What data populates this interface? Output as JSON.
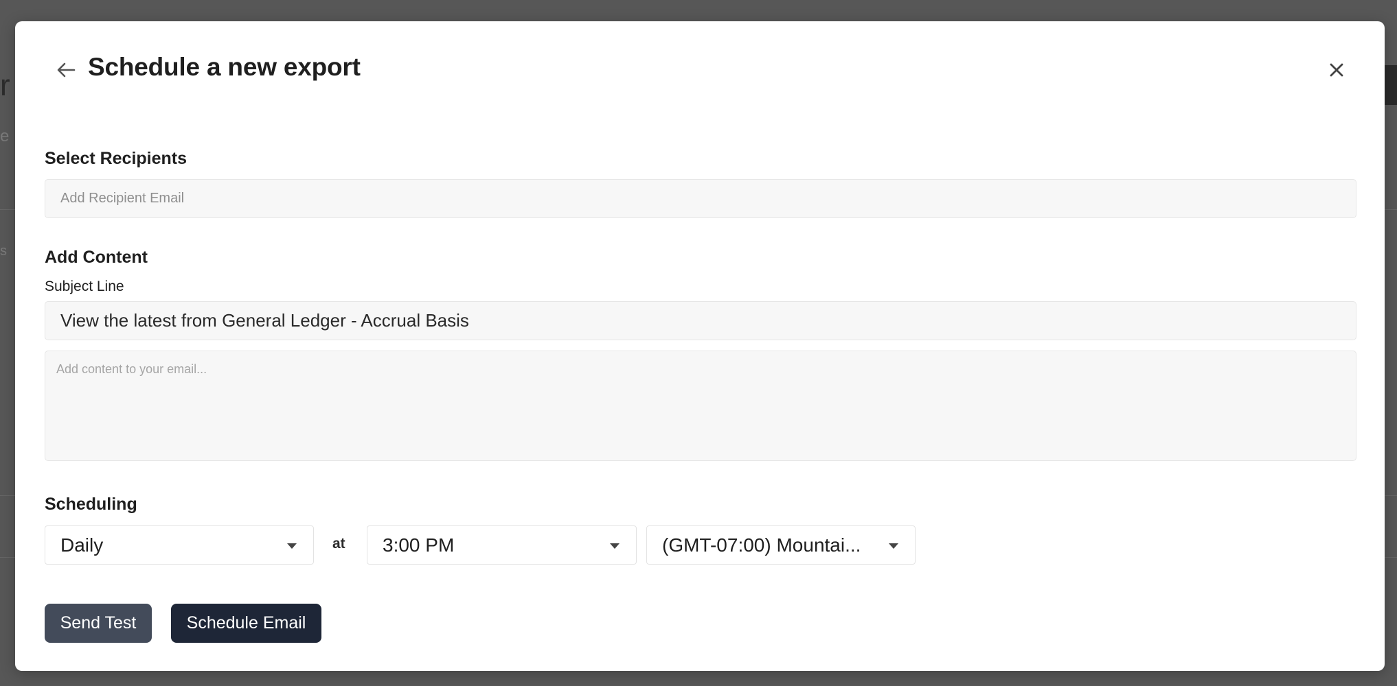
{
  "modal": {
    "title": "Schedule a new export",
    "icons": {
      "back": "arrow-left-icon",
      "close": "close-icon"
    }
  },
  "recipients": {
    "label": "Select Recipients",
    "placeholder": "Add Recipient Email",
    "value": ""
  },
  "content": {
    "label": "Add Content",
    "subject_label": "Subject Line",
    "subject_value": "View the latest from General Ledger - Accrual Basis",
    "body_placeholder": "Add content to your email...",
    "body_value": ""
  },
  "scheduling": {
    "label": "Scheduling",
    "frequency": "Daily",
    "at_label": "at",
    "time": "3:00 PM",
    "timezone": "(GMT-07:00) Mountai..."
  },
  "actions": {
    "send_test": "Send Test",
    "schedule_email": "Schedule Email"
  },
  "colors": {
    "backdrop": "#575757",
    "primary_button": "#1e2637",
    "secondary_button": "#434b5a",
    "field_background": "#f7f7f7"
  }
}
